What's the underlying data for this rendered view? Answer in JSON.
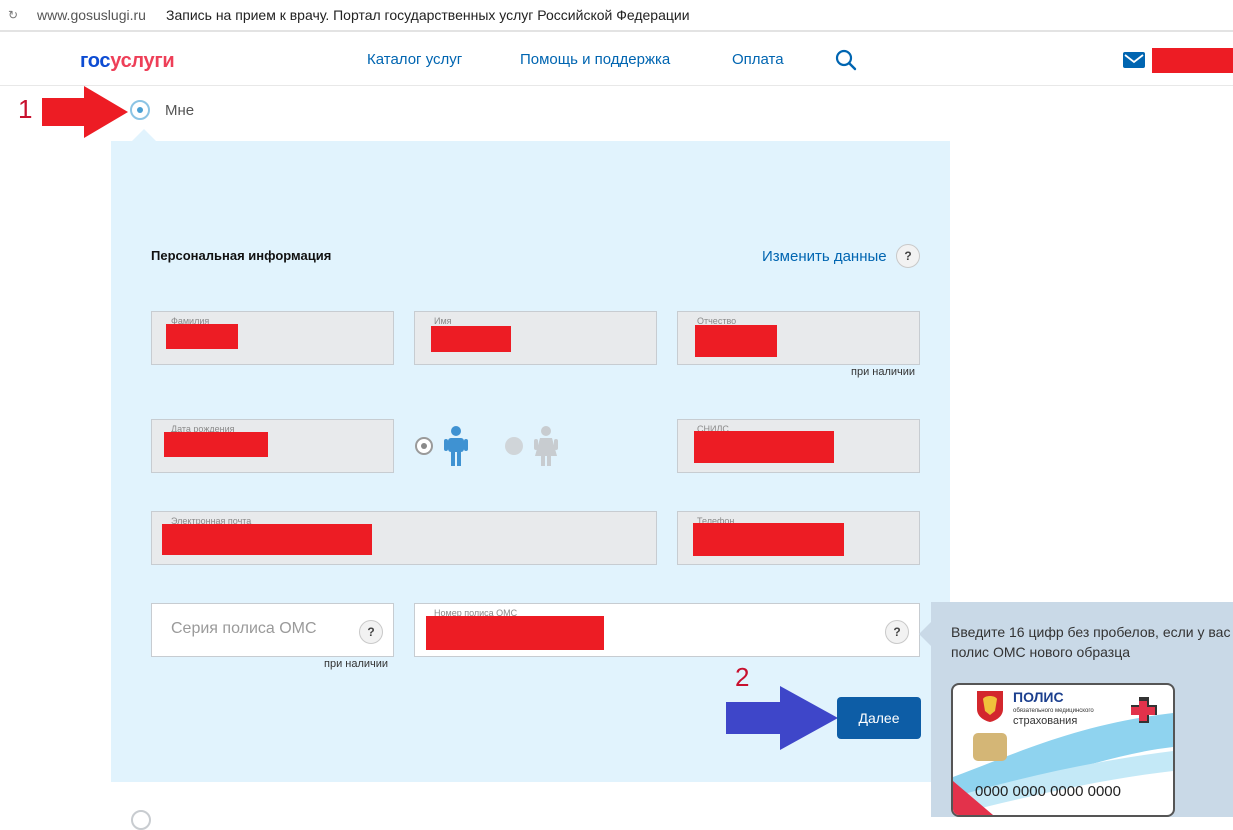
{
  "browser": {
    "domain": "www.gosuslugi.ru",
    "page_title": "Запись на прием к врачу. Портал государственных услуг Российской Федерации"
  },
  "header": {
    "logo_part1": "гос",
    "logo_part2": "услуги",
    "nav": [
      "Каталог услуг",
      "Помощь и поддержка",
      "Оплата"
    ],
    "icons": [
      "search-icon",
      "mail-icon"
    ]
  },
  "recipient": {
    "option_label": "Мне"
  },
  "form": {
    "section_title": "Персональная информация",
    "change_link": "Изменить данные",
    "help": "?",
    "fields": {
      "surname": "Фамилия",
      "name": "Имя",
      "patronymic": "Отчество",
      "birthdate": "Дата рождения",
      "snils": "СНИЛС",
      "email": "Электронная почта",
      "phone": "Телефон",
      "oms_number": "Номер полиса ОМС"
    },
    "oms_series_placeholder": "Серия полиса ОМС",
    "optional_hint": "при наличии",
    "next_button": "Далее"
  },
  "tooltip": {
    "text": "Введите 16 цифр без пробелов, если у вас полис ОМС нового образца",
    "card_title": "ПОЛИС",
    "card_subtitle_1": "обязательного медицинского",
    "card_subtitle_2": "страхования",
    "card_number": "0000 0000 0000 0000"
  },
  "annotations": {
    "first": "1",
    "second": "2"
  },
  "colors": {
    "redaction": "#ed1c24",
    "annotation_arrow_1": "#ed1c24",
    "annotation_arrow_2": "#3e46c9",
    "panel_bg": "#e1f3fd",
    "link": "#0065b1",
    "button": "#0d5da6"
  }
}
